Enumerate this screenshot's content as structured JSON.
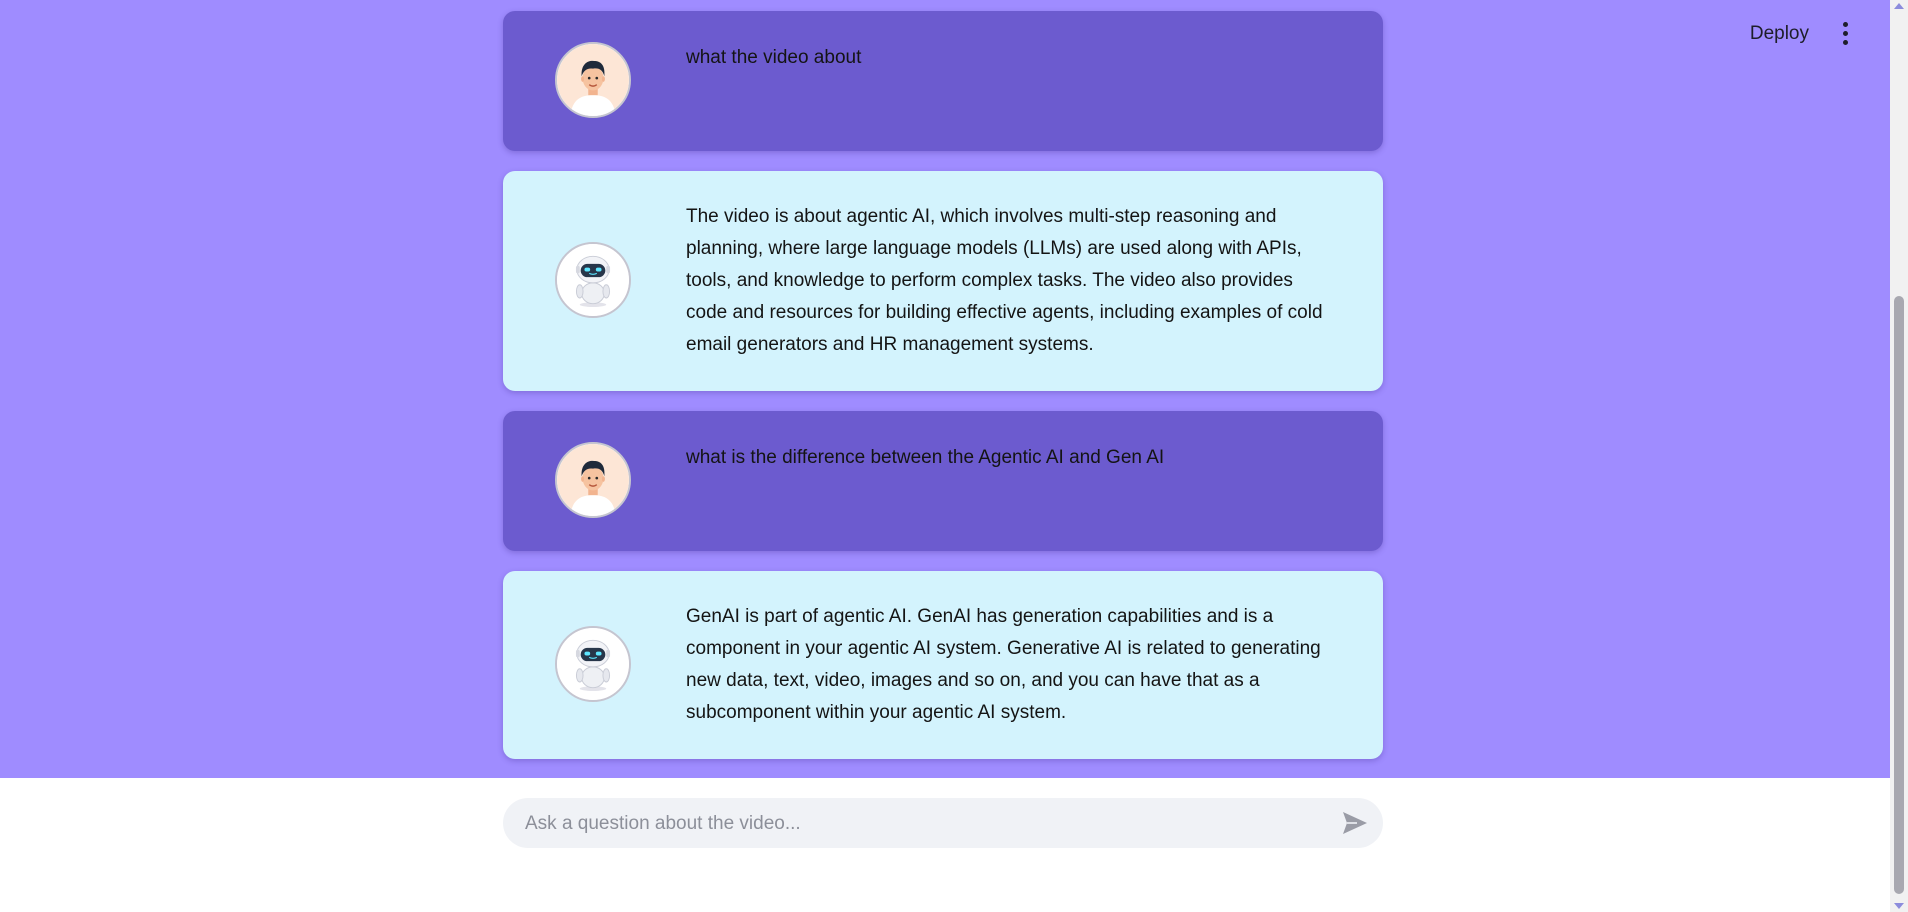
{
  "toolbar": {
    "deploy_label": "Deploy"
  },
  "messages": [
    {
      "role": "user",
      "avatar_icon": "user-avatar-icon",
      "text": "what the video about"
    },
    {
      "role": "assistant",
      "avatar_icon": "robot-avatar-icon",
      "text": "The video is about agentic AI, which involves multi-step reasoning and planning, where large language models (LLMs) are used along with APIs, tools, and knowledge to perform complex tasks. The video also provides code and resources for building effective agents, including examples of cold email generators and HR management systems."
    },
    {
      "role": "user",
      "avatar_icon": "user-avatar-icon",
      "text": "what is the difference between the Agentic AI and Gen AI"
    },
    {
      "role": "assistant",
      "avatar_icon": "robot-avatar-icon",
      "text": "GenAI is part of agentic AI. GenAI has generation capabilities and is a component in your agentic AI system. Generative AI is related to generating new data, text, video, images and so on, and you can have that as a subcomponent within your agentic AI system."
    }
  ],
  "chat_input": {
    "placeholder": "Ask a question about the video...",
    "value": ""
  },
  "colors": {
    "app_background": "#9f8cff",
    "user_message_bg": "#6c5bcf",
    "assistant_message_bg": "#d3f3fd",
    "input_bg": "#f0f2f6"
  }
}
